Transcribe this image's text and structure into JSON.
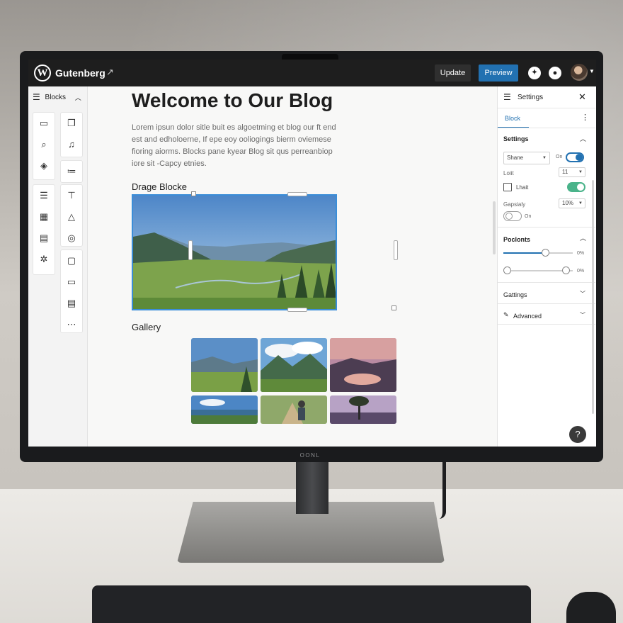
{
  "topbar": {
    "app_title": "Gutenberg",
    "update_label": "Update",
    "preview_label": "Preview"
  },
  "leftbar": {
    "header_label": "Blocks",
    "tools": [
      "document-icon",
      "search-icon",
      "layers-icon",
      "paragraph-icon",
      "grid-icon",
      "card-icon",
      "settings-icon",
      "copy-icon",
      "bell-icon",
      "list-icon",
      "lamp-icon",
      "triangle-icon",
      "check-circle-icon",
      "box-icon",
      "monitor-icon",
      "table-icon",
      "more-icon"
    ]
  },
  "post": {
    "title": "Welcome to Our Blog",
    "body": "Lorem ipsun dolor sitle buit es algoetming et blog our ft end est and edholoerne, If epe eoy ooliogings bierm oviemese fioring aiorms. Blocks pane kyear Blog sit qus perreanbiop iore sit -Capcy etnies.",
    "drag_heading": "Drage Blocke",
    "gallery_heading": "Gallery"
  },
  "settings_panel": {
    "header_title": "Settings",
    "tab_block": "Block",
    "section_settings": "Settings",
    "select_shane": "Shane",
    "on_label": "On",
    "row_loiit": "Loiit",
    "select_11": "11",
    "row_lhait": "Lhait",
    "row_gapsialy": "Gapsialy",
    "select_10": "10%",
    "on_label_2": "On",
    "section_poclonts": "Poclonts",
    "slider1_value": "0%",
    "slider2_value": "0%",
    "slider1_level": 0.6,
    "slider2_level": 0.9,
    "section_gattings": "Gattings",
    "section_advanced": "Advanced"
  },
  "monitor": {
    "brand": "OONL"
  },
  "help_label": "?",
  "colors": {
    "topbar": "#1e1e1e",
    "accent_blue": "#2271b1",
    "toggle_green": "#4ab38a"
  }
}
